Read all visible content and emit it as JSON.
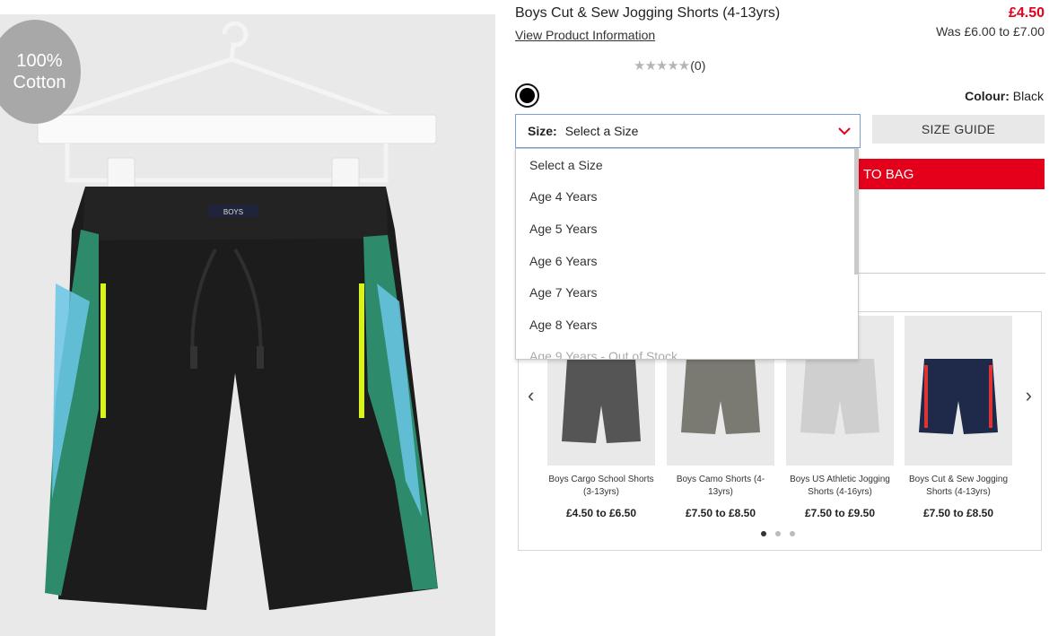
{
  "image": {
    "badge_line1": "100%",
    "badge_line2": "Cotton",
    "label_text": "BOYS"
  },
  "product": {
    "title": "Boys Cut & Sew Jogging Shorts (4-13yrs)",
    "view_info": "View Product Information",
    "price": "£4.50",
    "was_price": "Was £6.00 to £7.00",
    "rating_stars": "★★★★★",
    "rating_count": "(0)",
    "colour_label": "Colour:",
    "colour_value": "Black",
    "swatch_color": "#000000"
  },
  "size_select": {
    "label": "Size:",
    "value": "Select a Size",
    "options": [
      "Select a Size",
      "Age 4 Years",
      "Age 5 Years",
      "Age 6 Years",
      "Age 7 Years",
      "Age 8 Years",
      "Age 9 Years - Out of Stock"
    ]
  },
  "size_guide": "SIZE GUIDE",
  "add_to_bag": "TO BAG",
  "carousel": {
    "prev": "‹",
    "next": "›",
    "items": [
      {
        "name": "Boys Cargo School Shorts (3-13yrs)",
        "price": "£4.50 to £6.50",
        "color": "#555555"
      },
      {
        "name": "Boys Camo Shorts (4-13yrs)",
        "price": "£7.50 to £8.50",
        "color": "#7a7a72"
      },
      {
        "name": "Boys US Athletic Jogging Shorts (4-16yrs)",
        "price": "£7.50 to £9.50",
        "color": "#cfcfcf"
      },
      {
        "name": "Boys Cut & Sew Jogging Shorts (4-13yrs)",
        "price": "£7.50 to £8.50",
        "color": "#1f2a4a"
      }
    ]
  },
  "colors": {
    "accent_red": "#e4001b",
    "select_border": "#7aa0d6"
  }
}
